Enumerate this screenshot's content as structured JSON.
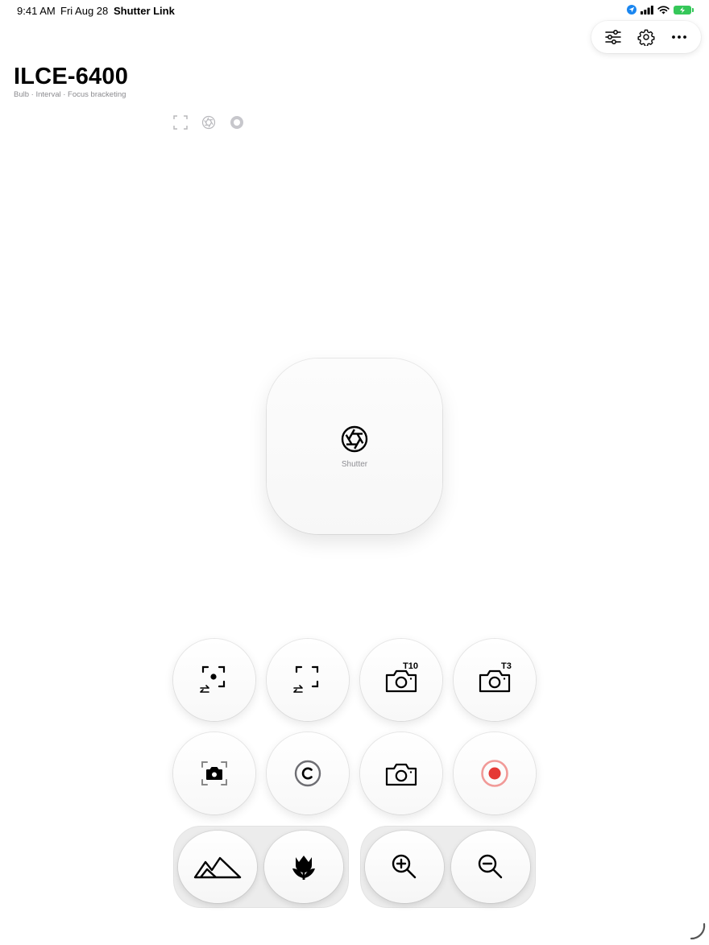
{
  "status_bar": {
    "time": "9:41 AM",
    "date": "Fri Aug 28",
    "app_name": "Shutter Link",
    "icons": [
      "location-icon",
      "cellular-signal-icon",
      "wifi-icon",
      "battery-charging-icon"
    ],
    "battery_color": "#35c759"
  },
  "toolbar": {
    "buttons": [
      {
        "icon": "sliders-icon"
      },
      {
        "icon": "gear-icon"
      },
      {
        "icon": "more-icon"
      }
    ]
  },
  "device": {
    "name": "ILCE-6400",
    "modes": "Bulb · Interval · Focus bracketing"
  },
  "mini_icons": [
    "focus-frame-icon",
    "aperture-icon",
    "record-dot-icon"
  ],
  "shutter": {
    "label": "Shutter",
    "icon": "aperture-icon"
  },
  "controls": {
    "row1": [
      {
        "icon": "af-point-swap-icon"
      },
      {
        "icon": "af-area-swap-icon"
      },
      {
        "icon": "camera-timer-icon",
        "badge": "T10"
      },
      {
        "icon": "camera-timer-icon",
        "badge": "T3"
      }
    ],
    "row2": [
      {
        "icon": "focus-camera-icon"
      },
      {
        "icon": "custom-c-icon"
      },
      {
        "icon": "camera-icon"
      },
      {
        "icon": "record-icon",
        "color": "#e53935"
      }
    ],
    "group_left": [
      {
        "icon": "landscape-icon"
      },
      {
        "icon": "macro-tulip-icon"
      }
    ],
    "group_right": [
      {
        "icon": "zoom-in-icon"
      },
      {
        "icon": "zoom-out-icon"
      }
    ]
  },
  "accent_colors": {
    "record": "#e53935",
    "location": "#1a86f0"
  }
}
